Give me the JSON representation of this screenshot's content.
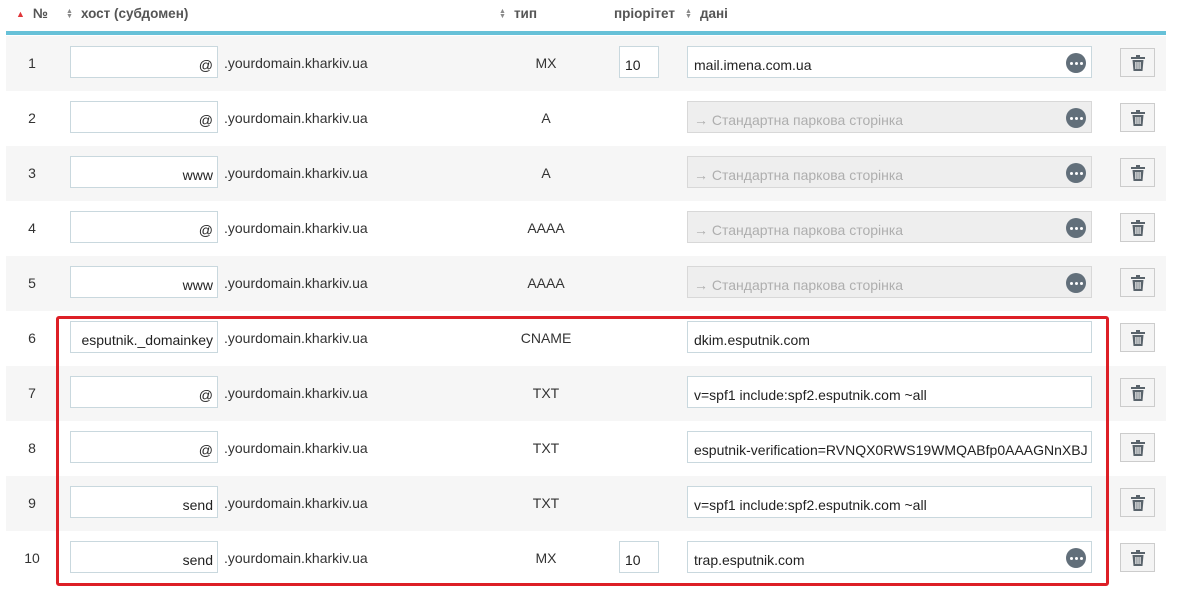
{
  "header": {
    "num_label": "№",
    "host_label": "хост (субдомен)",
    "type_label": "тип",
    "priority_label": "пріорітет",
    "data_label": "дані"
  },
  "colors": {
    "accent_line": "#67c1d8",
    "sort_active": "#e0363a",
    "highlight_border": "#dd1f26",
    "more_button": "#626f7a"
  },
  "rows": [
    {
      "num": "1",
      "host": "@",
      "domain": ".yourdomain.kharkiv.ua",
      "type": "MX",
      "priority": "10",
      "data": "mail.imena.com.ua",
      "data_disabled": false,
      "has_more": true
    },
    {
      "num": "2",
      "host": "@",
      "domain": ".yourdomain.kharkiv.ua",
      "type": "A",
      "priority": "",
      "data": "→ Стандартна паркова сторінка",
      "data_disabled": true,
      "has_more": true
    },
    {
      "num": "3",
      "host": "www",
      "domain": ".yourdomain.kharkiv.ua",
      "type": "A",
      "priority": "",
      "data": "→ Стандартна паркова сторінка",
      "data_disabled": true,
      "has_more": true
    },
    {
      "num": "4",
      "host": "@",
      "domain": ".yourdomain.kharkiv.ua",
      "type": "AAAA",
      "priority": "",
      "data": "→ Стандартна паркова сторінка",
      "data_disabled": true,
      "has_more": true
    },
    {
      "num": "5",
      "host": "www",
      "domain": ".yourdomain.kharkiv.ua",
      "type": "AAAA",
      "priority": "",
      "data": "→ Стандартна паркова сторінка",
      "data_disabled": true,
      "has_more": true
    },
    {
      "num": "6",
      "host": "esputnik._domainkey",
      "domain": ".yourdomain.kharkiv.ua",
      "type": "CNAME",
      "priority": "",
      "data": "dkim.esputnik.com",
      "data_disabled": false,
      "has_more": false
    },
    {
      "num": "7",
      "host": "@",
      "domain": ".yourdomain.kharkiv.ua",
      "type": "TXT",
      "priority": "",
      "data": "v=spf1 include:spf2.esputnik.com ~all",
      "data_disabled": false,
      "has_more": false
    },
    {
      "num": "8",
      "host": "@",
      "domain": ".yourdomain.kharkiv.ua",
      "type": "TXT",
      "priority": "",
      "data": "esputnik-verification=RVNQX0RWS19WMQABfp0AAAGNnXBJ",
      "data_disabled": false,
      "has_more": false
    },
    {
      "num": "9",
      "host": "send",
      "domain": ".yourdomain.kharkiv.ua",
      "type": "TXT",
      "priority": "",
      "data": "v=spf1 include:spf2.esputnik.com ~all",
      "data_disabled": false,
      "has_more": false
    },
    {
      "num": "10",
      "host": "send",
      "domain": ".yourdomain.kharkiv.ua",
      "type": "MX",
      "priority": "10",
      "data": "trap.esputnik.com",
      "data_disabled": false,
      "has_more": true
    }
  ]
}
